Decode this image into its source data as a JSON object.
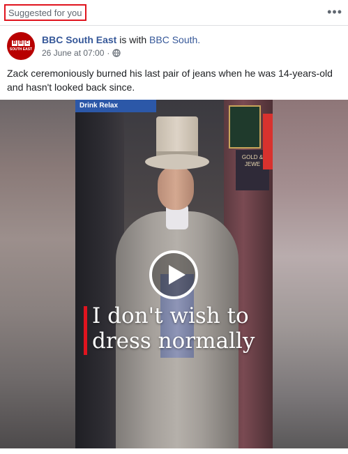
{
  "post": {
    "suggested_label": "Suggested for you",
    "more_icon": "more-options-icon",
    "page_name": "BBC South East",
    "with_text": " is with ",
    "with_page": "BBC South.",
    "date": "26 June at 07:00",
    "separator": "·",
    "privacy_icon": "globe-icon",
    "avatar_top": "BBC",
    "avatar_sub": "SOUTH EAST",
    "text": "Zack ceremoniously burned his last pair of jeans when he was 14-years-old and hasn't looked back since."
  },
  "video": {
    "caption": "I don't wish to dress normally",
    "play_icon": "play-icon",
    "sign_text": "Drink Relax",
    "shop_sign_text": "GOLD & JEWE",
    "colors": {
      "caption_accent": "#e0141e",
      "brand_red": "#b80000",
      "link_blue": "#365899"
    }
  }
}
